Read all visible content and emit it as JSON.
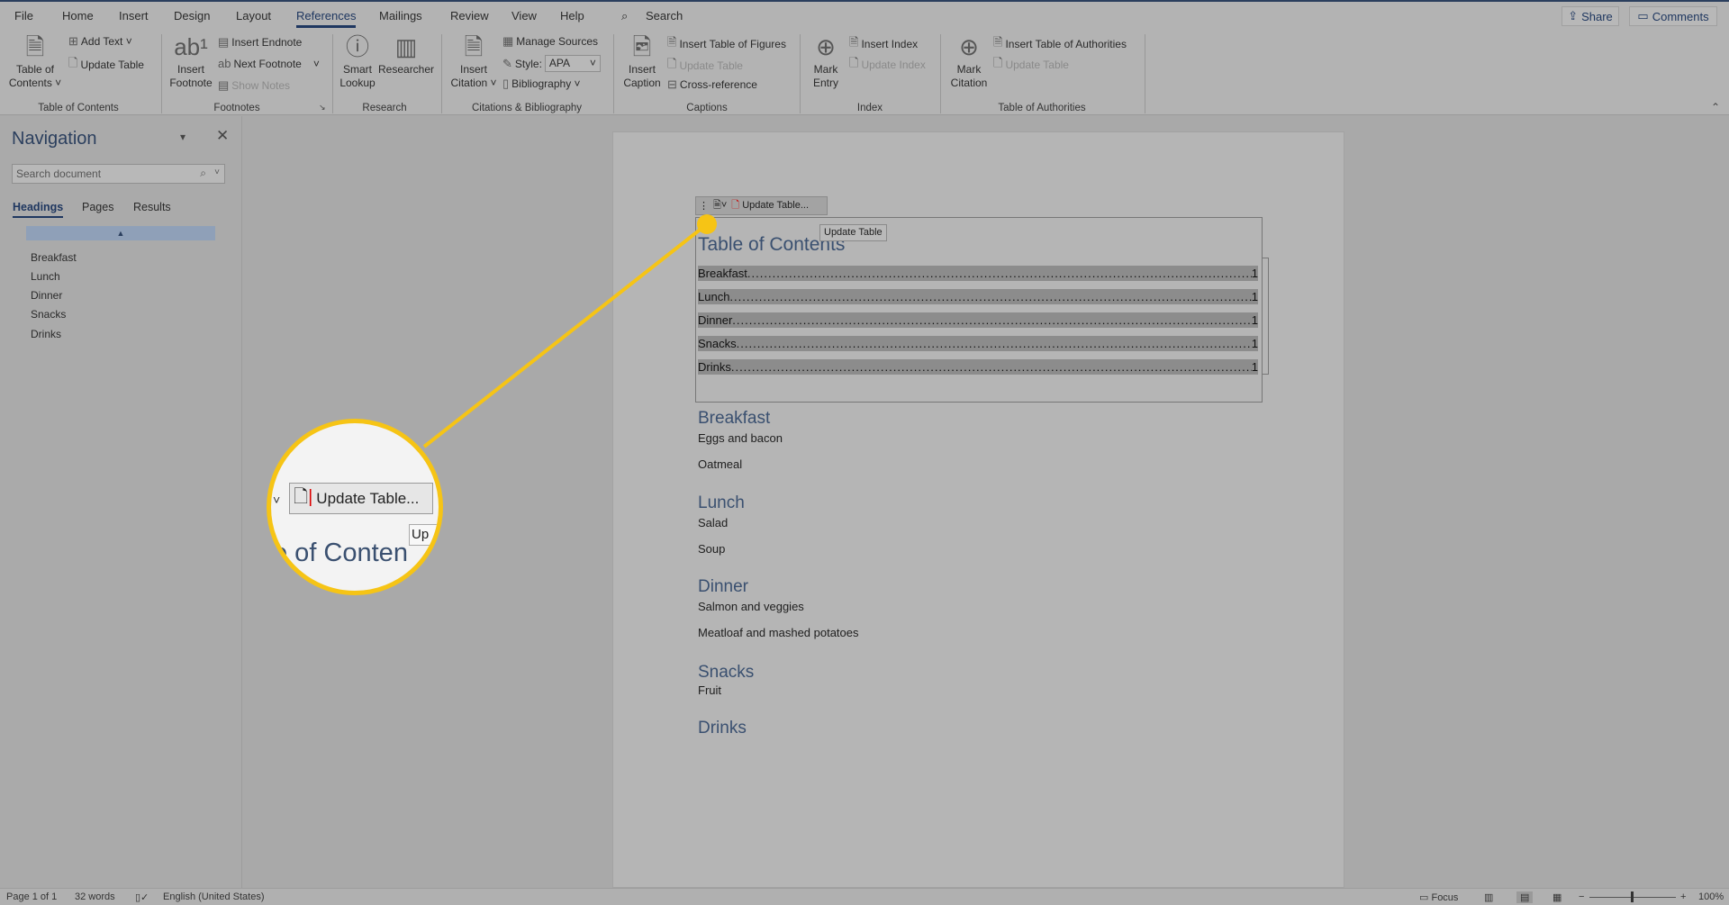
{
  "menu": {
    "items": [
      "File",
      "Home",
      "Insert",
      "Design",
      "Layout",
      "References",
      "Mailings",
      "Review",
      "View",
      "Help"
    ],
    "active": "References",
    "search": "Search",
    "share": "Share",
    "comments": "Comments"
  },
  "ribbon": {
    "toc": {
      "big1": "Table of",
      "big2": "Contents ˅",
      "add_text": "Add Text ˅",
      "update_table": "Update Table",
      "label": "Table of Contents"
    },
    "footnotes": {
      "big1": "Insert",
      "big2": "Footnote",
      "insert_endnote": "Insert Endnote",
      "next_footnote": "Next Footnote",
      "show_notes": "Show Notes",
      "label": "Footnotes"
    },
    "research": {
      "smart1": "Smart",
      "smart2": "Lookup",
      "researcher": "Researcher",
      "label": "Research"
    },
    "citations": {
      "big1": "Insert",
      "big2": "Citation ˅",
      "manage_sources": "Manage Sources",
      "style_label": "Style:",
      "style_value": "APA",
      "bibliography": "Bibliography ˅",
      "label": "Citations & Bibliography"
    },
    "captions": {
      "big1": "Insert",
      "big2": "Caption",
      "insert_tof": "Insert Table of Figures",
      "update_table": "Update Table",
      "cross_reference": "Cross-reference",
      "label": "Captions"
    },
    "index": {
      "big1": "Mark",
      "big2": "Entry",
      "insert_index": "Insert Index",
      "update_index": "Update Index",
      "label": "Index"
    },
    "toa": {
      "big1": "Mark",
      "big2": "Citation",
      "insert_toa": "Insert Table of Authorities",
      "update_table": "Update Table",
      "label": "Table of Authorities"
    }
  },
  "nav": {
    "title": "Navigation",
    "search_placeholder": "Search document",
    "tabs": [
      "Headings",
      "Pages",
      "Results"
    ],
    "items": [
      "Breakfast",
      "Lunch",
      "Dinner",
      "Snacks",
      "Drinks"
    ]
  },
  "document": {
    "toc_toolbar_button": "Update Table...",
    "tooltip": "Update Table",
    "toc_title": "Table of Contents",
    "toc_entries": [
      {
        "title": "Breakfast",
        "page": "1"
      },
      {
        "title": "Lunch",
        "page": "1"
      },
      {
        "title": "Dinner",
        "page": "1"
      },
      {
        "title": "Snacks",
        "page": "1"
      },
      {
        "title": "Drinks",
        "page": "1"
      }
    ],
    "sections": [
      {
        "heading": "Breakfast",
        "items": [
          "Eggs and bacon",
          "Oatmeal"
        ]
      },
      {
        "heading": "Lunch",
        "items": [
          "Salad",
          "Soup"
        ]
      },
      {
        "heading": "Dinner",
        "items": [
          "Salmon and veggies",
          "Meatloaf and mashed potatoes"
        ]
      },
      {
        "heading": "Snacks",
        "items": [
          "Fruit"
        ]
      },
      {
        "heading": "Drinks",
        "items": []
      }
    ]
  },
  "callout": {
    "button": "Update Table...",
    "heading_fragment": "e of Conten",
    "tooltip_fragment": "Up",
    "color": "#f6c415"
  },
  "status": {
    "page": "Page 1 of 1",
    "words": "32 words",
    "language": "English (United States)",
    "focus": "Focus",
    "zoom": "100%"
  }
}
